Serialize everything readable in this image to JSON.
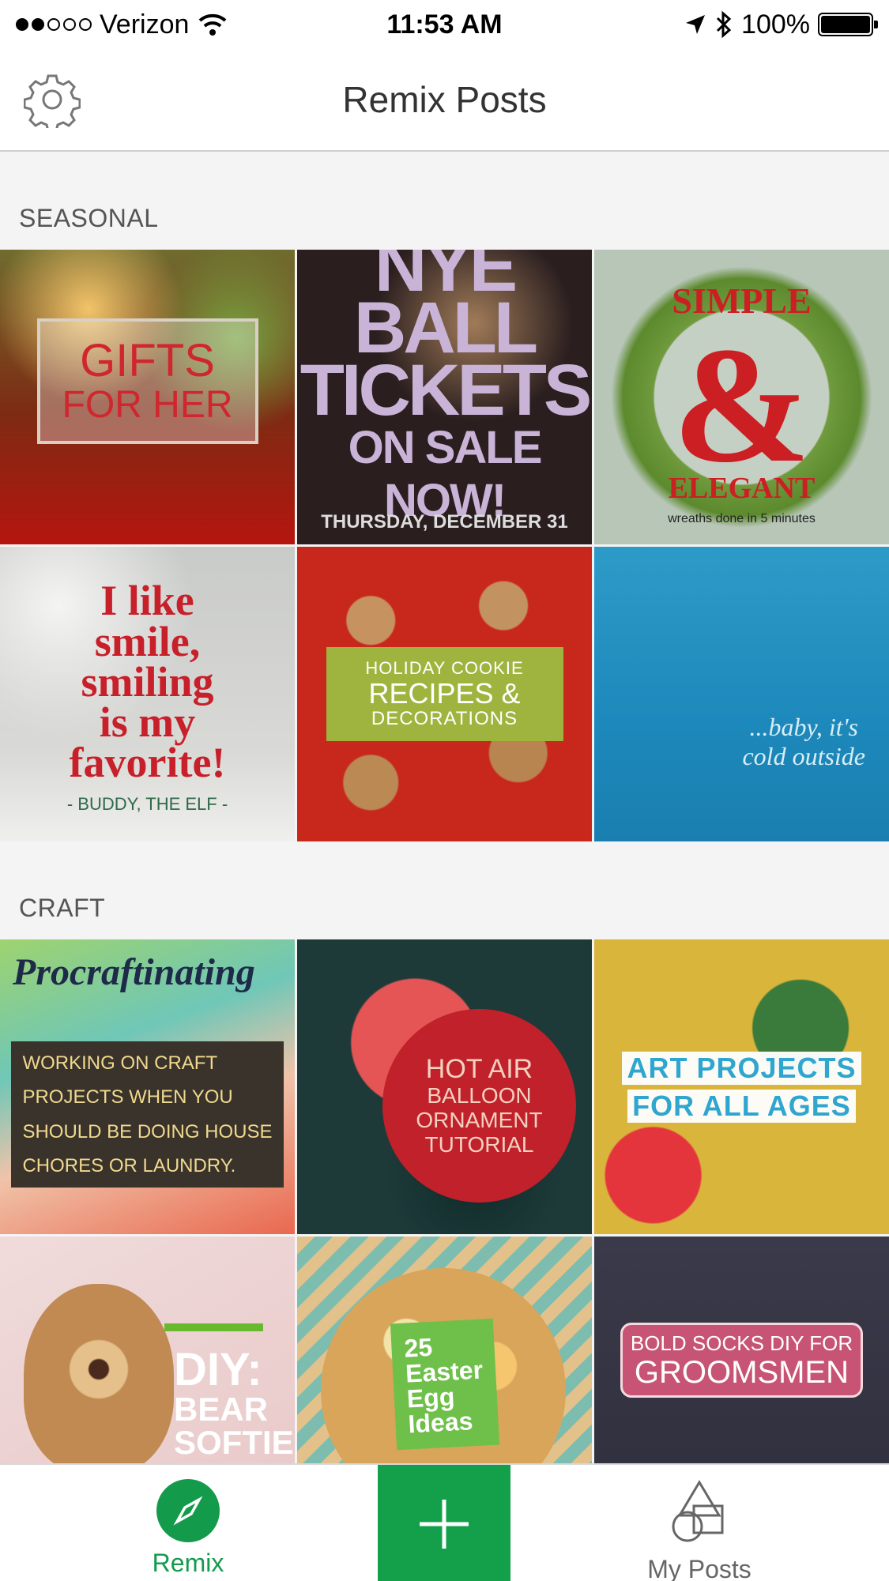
{
  "status_bar": {
    "carrier": "Verizon",
    "time": "11:53 AM",
    "battery": "100%",
    "battery_level": 1.0
  },
  "nav": {
    "title": "Remix Posts"
  },
  "sections": [
    {
      "title": "SEASONAL",
      "tiles": [
        {
          "lines": [
            "GIFTS",
            "FOR HER"
          ]
        },
        {
          "lines": [
            "NYE BALL",
            "TICKETS",
            "ON SALE NOW!",
            "THURSDAY, DECEMBER 31"
          ]
        },
        {
          "lines": [
            "SIMPLE",
            "&",
            "ELEGANT",
            "wreaths done in 5 minutes"
          ]
        },
        {
          "lines": [
            "I like",
            "smile,",
            "smiling",
            "is my",
            "favorite!",
            "- BUDDY, THE ELF -"
          ]
        },
        {
          "lines": [
            "HOLIDAY COOKIE",
            "RECIPES &",
            "DECORATIONS"
          ]
        },
        {
          "lines": [
            "...baby, it's",
            "cold outside"
          ]
        }
      ]
    },
    {
      "title": "CRAFT",
      "tiles": [
        {
          "lines": [
            "Procraftinating",
            "WORKING ON CRAFT",
            "PROJECTS WHEN YOU",
            "SHOULD BE DOING HOUSE",
            "CHORES OR LAUNDRY."
          ]
        },
        {
          "lines": [
            "HOT AIR",
            "BALLOON",
            "ORNAMENT",
            "TUTORIAL"
          ]
        },
        {
          "lines": [
            "ART PROJECTS",
            "FOR ALL AGES"
          ]
        },
        {
          "lines": [
            "DIY:",
            "BEAR",
            "SOFTIE"
          ]
        },
        {
          "lines": [
            "25",
            "Easter",
            "Egg",
            "Ideas"
          ]
        },
        {
          "lines": [
            "BOLD SOCKS DIY FOR",
            "GROOMSMEN"
          ]
        }
      ]
    }
  ],
  "tab_bar": {
    "remix_label": "Remix",
    "my_posts_label": "My Posts",
    "active_tab": "Remix"
  },
  "colors": {
    "accent": "#14a04b",
    "tab_inactive": "#666666"
  },
  "icons": {
    "settings": "gear-icon",
    "remix": "compass-icon",
    "create": "plus-icon",
    "my_posts": "shapes-icon",
    "wifi": "wifi-icon",
    "location": "location-arrow-icon",
    "bluetooth": "bluetooth-icon",
    "battery": "battery-icon"
  }
}
